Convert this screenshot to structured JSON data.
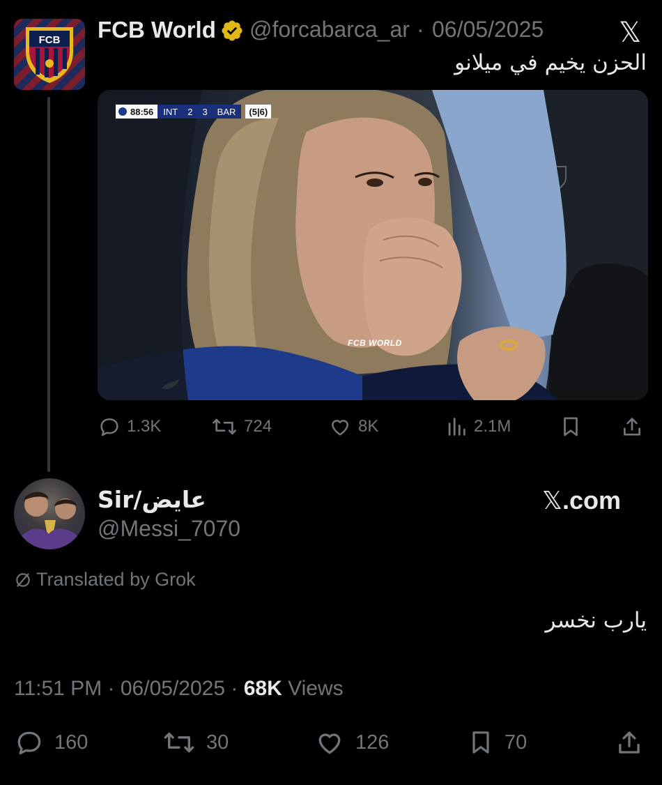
{
  "quoted": {
    "name": "FCB World",
    "handle": "@forcabarca_ar",
    "separator": "·",
    "date": "06/05/2025",
    "text": "الحزن يخيم في ميلانو",
    "avatar_text": "FCB",
    "media": {
      "scorebug": {
        "clock": "88:56",
        "home": "INT",
        "home_score": "2",
        "away_score": "3",
        "away": "BAR",
        "aggregate": "(5|6)"
      },
      "watermark": "FCB WORLD"
    },
    "actions": {
      "replies": "1.3K",
      "reposts": "724",
      "likes": "8K",
      "views": "2.1M"
    }
  },
  "reply": {
    "name": "Sir/عايض",
    "handle": "@Messi_7070",
    "site": ".com",
    "translated_label": "Translated by Grok",
    "text": "يارب نخسر",
    "meta": {
      "time": "11:51 PM",
      "sep1": "·",
      "date": "06/05/2025",
      "sep2": "·",
      "views_count": "68K",
      "views_label": "Views"
    },
    "actions": {
      "replies": "160",
      "reposts": "30",
      "likes": "126",
      "bookmarks": "70"
    }
  },
  "colors": {
    "background": "#000000",
    "text": "#e7e9ea",
    "muted": "#71767b",
    "verified": "#e2b719"
  },
  "icons": [
    "x-logo",
    "verified-badge-icon",
    "reply-icon",
    "repost-icon",
    "like-icon",
    "views-icon",
    "bookmark-icon",
    "share-icon",
    "grok-translate-icon"
  ]
}
